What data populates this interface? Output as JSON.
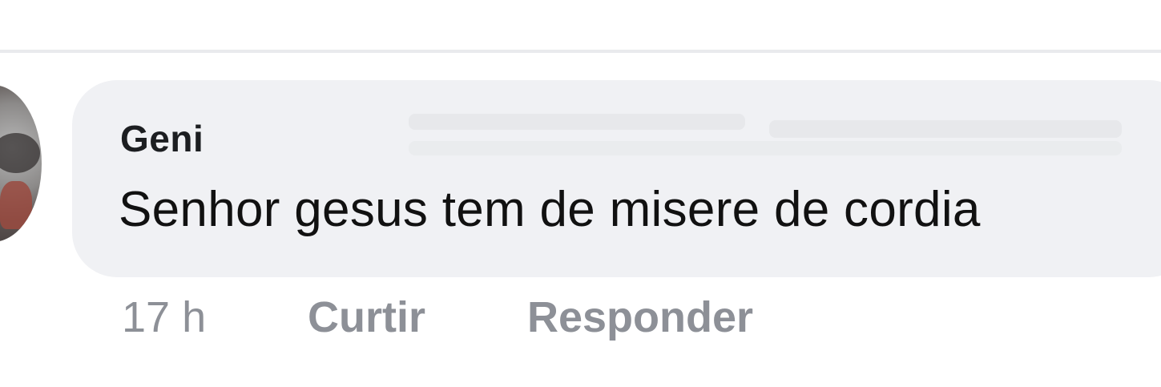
{
  "comment": {
    "author": "Geni",
    "text": "Senhor gesus tem de misere de cordia",
    "timestamp": "17 h",
    "actions": {
      "like_label": "Curtir",
      "reply_label": "Responder"
    }
  },
  "colors": {
    "bubble_background": "#f0f1f4",
    "action_text": "#8d9097",
    "author_text": "#1c1e21"
  }
}
